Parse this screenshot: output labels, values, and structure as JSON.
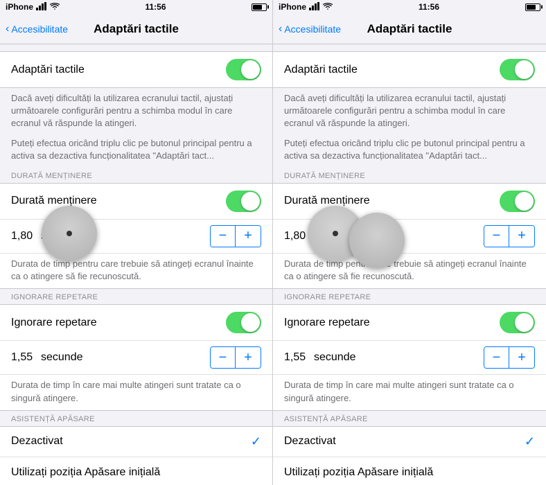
{
  "panels": [
    {
      "id": "left",
      "statusBar": {
        "carrier": "iPhone",
        "time": "11:56",
        "battery": 70
      },
      "navBack": "Accesibilitate",
      "navTitle": "Adaptări tactile",
      "mainToggleLabel": "Adaptări tactile",
      "mainDesc1": "Dacă aveți dificultăți la utilizarea ecranului tactil, ajustați următoarele configurări pentru a schimba modul în care ecranul vă răspunde la atingeri.",
      "mainDesc2": "Puteți efectua oricând triplu clic pe butonul principal pentru a activa sa dezactiva funcționalitatea \"Adaptări tact...",
      "sections": [
        {
          "header": "DURATĂ MENȚINERE",
          "rows": [
            {
              "type": "toggle",
              "label": "Durată menținere",
              "on": true
            },
            {
              "type": "stepper",
              "value": "1,80",
              "unit": "secunde",
              "hasDial": true,
              "dialLeft": true
            },
            {
              "type": "desc",
              "text": "Durata de timp pentru care trebuie să atingeți ecranul înainte ca o atingere să fie recunoscută."
            }
          ]
        },
        {
          "header": "IGNORARE REPETARE",
          "rows": [
            {
              "type": "toggle",
              "label": "Ignorare repetare",
              "on": true
            },
            {
              "type": "stepper",
              "value": "1,55",
              "unit": "secunde",
              "hasDial": false
            },
            {
              "type": "desc",
              "text": "Durata de timp în care mai multe atingeri sunt tratate ca o singură atingere."
            }
          ]
        },
        {
          "header": "ASISTENȚĂ APĂSARE",
          "rows": [
            {
              "type": "checkrow",
              "label": "Dezactivat",
              "checked": true
            },
            {
              "type": "plain",
              "label": "Utilizați poziția Apăsare inițială"
            }
          ]
        }
      ]
    },
    {
      "id": "right",
      "statusBar": {
        "carrier": "iPhone",
        "time": "11:56",
        "battery": 70
      },
      "navBack": "Accesibilitate",
      "navTitle": "Adaptări tactile",
      "mainToggleLabel": "Adaptări tactile",
      "mainDesc1": "Dacă aveți dificultăți la utilizarea ecranului tactil, ajustați următoarele configurări pentru a schimba modul în care ecranul vă răspunde la atingeri.",
      "mainDesc2": "Puteți efectua oricând triplu clic pe butonul principal pentru a activa sa dezactiva funcționalitatea \"Adaptări tact...",
      "sections": [
        {
          "header": "DURATĂ MENȚINERE",
          "rows": [
            {
              "type": "toggle",
              "label": "Durată menținere",
              "on": true
            },
            {
              "type": "stepper",
              "value": "1,80",
              "unit": "secunde",
              "hasDial": true,
              "dialLeft": false,
              "dialRight": true
            },
            {
              "type": "desc",
              "text": "Durata de timp pentru care trebuie să atingeți ecranul înainte ca o atingere să fie recunoscută."
            }
          ]
        },
        {
          "header": "IGNORARE REPETARE",
          "rows": [
            {
              "type": "toggle",
              "label": "Ignorare repetare",
              "on": true
            },
            {
              "type": "stepper",
              "value": "1,55",
              "unit": "secunde",
              "hasDial": false
            },
            {
              "type": "desc",
              "text": "Durata de timp în care mai multe atingeri sunt tratate ca o singură atingere."
            }
          ]
        },
        {
          "header": "ASISTENȚĂ APĂSARE",
          "rows": [
            {
              "type": "checkrow",
              "label": "Dezactivat",
              "checked": true
            },
            {
              "type": "plain",
              "label": "Utilizați poziția Apăsare inițială"
            }
          ]
        }
      ]
    }
  ]
}
